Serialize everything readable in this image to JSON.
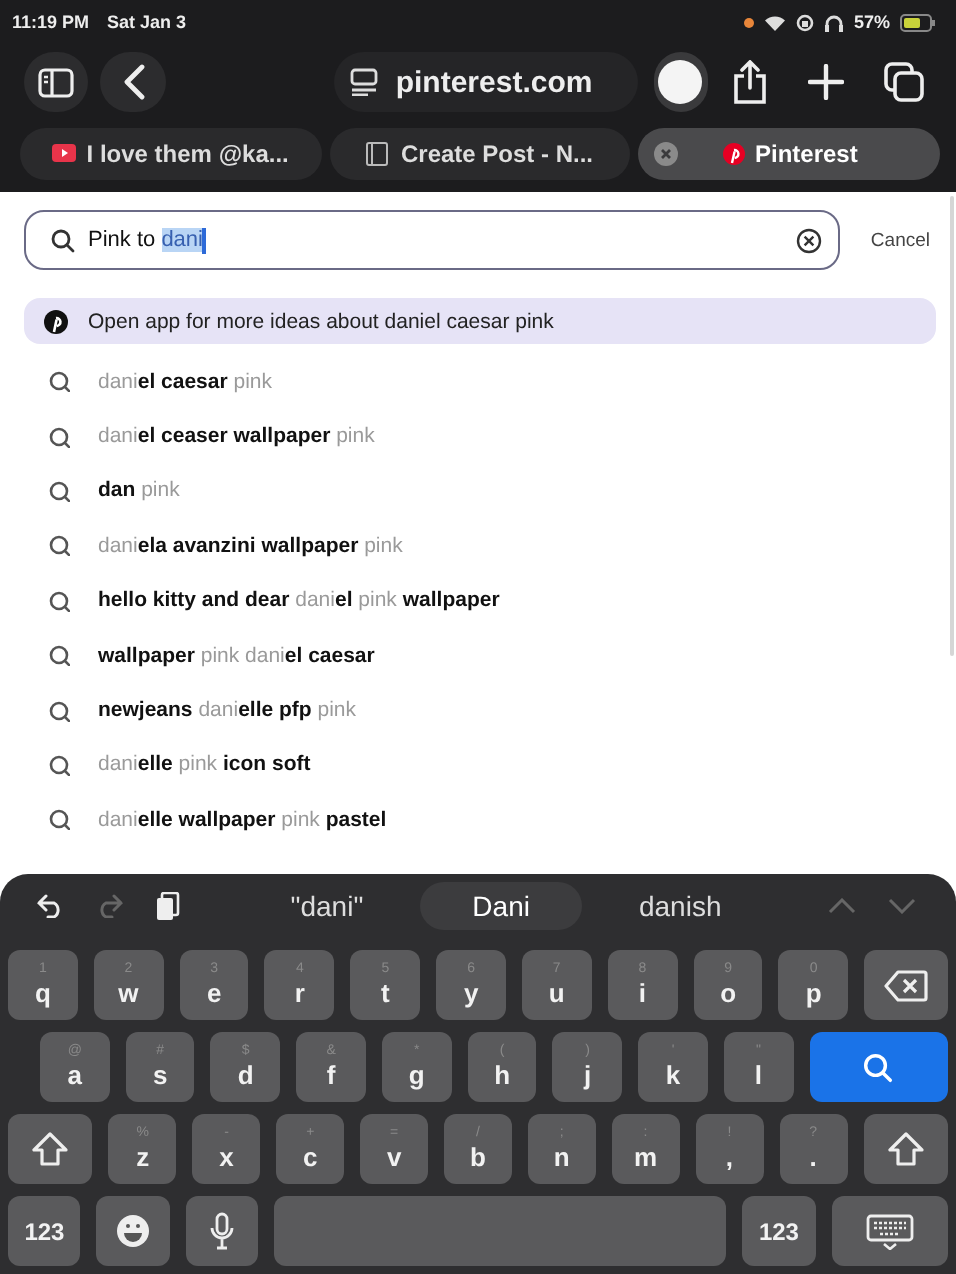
{
  "status_bar": {
    "time": "11:19 PM",
    "date": "Sat Jan 3",
    "battery": "57%"
  },
  "toolbar": {
    "address": "pinterest.com"
  },
  "tabs": [
    {
      "title": "I love them @ka...",
      "selected": false
    },
    {
      "title": "Create Post - N...",
      "selected": false
    },
    {
      "title": "Pinterest",
      "selected": true
    }
  ],
  "search": {
    "value": "Pink to ",
    "selected_text": "dani",
    "cancel": "Cancel"
  },
  "open_app": {
    "text": "Open app for more ideas about daniel caesar pink"
  },
  "suggestions": [
    "dani**el caesar** pink",
    "dani**el ceaser wallpaper** pink",
    "**dan** pink",
    "dani**ela avanzini wallpaper** pink",
    "**hello kitty and dear** dani**el** pink **wallpaper**",
    "**wallpaper** pink dani**el caesar**",
    "**newjeans** dani**elle pfp** pink",
    "dani**elle** pink **icon soft**",
    "dani**elle wallpaper** pink **pastel**"
  ],
  "keyboard": {
    "predictions": [
      {
        "text": "\"dani\"",
        "selected": false
      },
      {
        "text": "Dani",
        "selected": true
      },
      {
        "text": "danish",
        "selected": false
      }
    ],
    "rows": [
      [
        {
          "kind": "letter",
          "label": "q",
          "hint": "1"
        },
        {
          "kind": "letter",
          "label": "w",
          "hint": "2"
        },
        {
          "kind": "letter",
          "label": "e",
          "hint": "3"
        },
        {
          "kind": "letter",
          "label": "r",
          "hint": "4"
        },
        {
          "kind": "letter",
          "label": "t",
          "hint": "5"
        },
        {
          "kind": "letter",
          "label": "y",
          "hint": "6"
        },
        {
          "kind": "letter",
          "label": "u",
          "hint": "7"
        },
        {
          "kind": "letter",
          "label": "i",
          "hint": "8"
        },
        {
          "kind": "letter",
          "label": "o",
          "hint": "9"
        },
        {
          "kind": "letter",
          "label": "p",
          "hint": "0"
        },
        {
          "kind": "delete"
        }
      ],
      [
        {
          "kind": "letter",
          "label": "a",
          "hint": "@"
        },
        {
          "kind": "letter",
          "label": "s",
          "hint": "#"
        },
        {
          "kind": "letter",
          "label": "d",
          "hint": "$"
        },
        {
          "kind": "letter",
          "label": "f",
          "hint": "&"
        },
        {
          "kind": "letter",
          "label": "g",
          "hint": "*"
        },
        {
          "kind": "letter",
          "label": "h",
          "hint": "("
        },
        {
          "kind": "letter",
          "label": "j",
          "hint": ")"
        },
        {
          "kind": "letter",
          "label": "k",
          "hint": "'"
        },
        {
          "kind": "letter",
          "label": "l",
          "hint": "\""
        },
        {
          "kind": "search"
        }
      ],
      [
        {
          "kind": "shift"
        },
        {
          "kind": "letter",
          "label": "z",
          "hint": "%"
        },
        {
          "kind": "letter",
          "label": "x",
          "hint": "-"
        },
        {
          "kind": "letter",
          "label": "c",
          "hint": "+"
        },
        {
          "kind": "letter",
          "label": "v",
          "hint": "="
        },
        {
          "kind": "letter",
          "label": "b",
          "hint": "/"
        },
        {
          "kind": "letter",
          "label": "n",
          "hint": ";"
        },
        {
          "kind": "letter",
          "label": "m",
          "hint": ":"
        },
        {
          "kind": "letter",
          "label": ",",
          "hint": "!"
        },
        {
          "kind": "letter",
          "label": ".",
          "hint": "?"
        },
        {
          "kind": "shift"
        }
      ],
      [
        {
          "kind": "numbers",
          "label": "123"
        },
        {
          "kind": "emoji"
        },
        {
          "kind": "mic"
        },
        {
          "kind": "space"
        },
        {
          "kind": "numbers",
          "label": "123"
        },
        {
          "kind": "hide"
        }
      ]
    ]
  }
}
